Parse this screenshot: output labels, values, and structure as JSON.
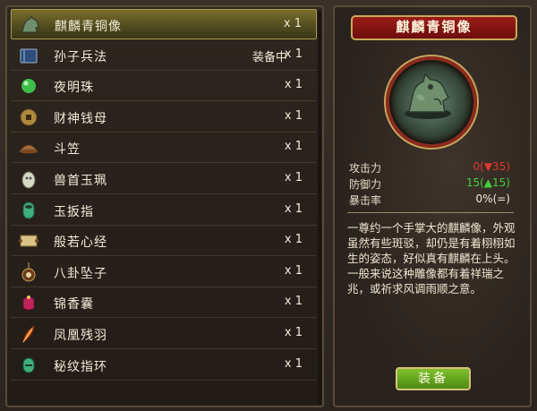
{
  "inventory": {
    "items": [
      {
        "name": "麒麟青铜像",
        "status": "",
        "qty": "x 1",
        "icon": "qilin-statue-icon",
        "selected": true
      },
      {
        "name": "孙子兵法",
        "status": "装备中",
        "qty": "x 1",
        "icon": "book-icon",
        "selected": false
      },
      {
        "name": "夜明珠",
        "status": "",
        "qty": "x 1",
        "icon": "pearl-icon",
        "selected": false
      },
      {
        "name": "财神钱母",
        "status": "",
        "qty": "x 1",
        "icon": "coin-icon",
        "selected": false
      },
      {
        "name": "斗笠",
        "status": "",
        "qty": "x 1",
        "icon": "bamboo-hat-icon",
        "selected": false
      },
      {
        "name": "兽首玉珮",
        "status": "",
        "qty": "x 1",
        "icon": "jade-pendant-icon",
        "selected": false
      },
      {
        "name": "玉扳指",
        "status": "",
        "qty": "x 1",
        "icon": "jade-ring-icon",
        "selected": false
      },
      {
        "name": "般若心经",
        "status": "",
        "qty": "x 1",
        "icon": "scroll-icon",
        "selected": false
      },
      {
        "name": "八卦坠子",
        "status": "",
        "qty": "x 1",
        "icon": "bagua-pendant-icon",
        "selected": false
      },
      {
        "name": "锦香囊",
        "status": "",
        "qty": "x 1",
        "icon": "sachet-icon",
        "selected": false
      },
      {
        "name": "凤凰残羽",
        "status": "",
        "qty": "x 1",
        "icon": "feather-icon",
        "selected": false
      },
      {
        "name": "秘纹指环",
        "status": "",
        "qty": "x 1",
        "icon": "rune-ring-icon",
        "selected": false
      }
    ]
  },
  "detail": {
    "title": "麒麟青铜像",
    "stats": [
      {
        "label": "攻击力",
        "value": "0(▼35)",
        "color": "#e0392b"
      },
      {
        "label": "防御力",
        "value": "15(▲15)",
        "color": "#3fd13a"
      },
      {
        "label": "暴击率",
        "value": "0%(=)",
        "color": "#f2ead6"
      }
    ],
    "description": "一尊约一个手掌大的麒麟像，外观虽然有些斑驳，却仍是有着栩栩如生的姿态，好似真有麒麟在上头。一般来说这种雕像都有着祥瑞之兆，或祈求风调雨顺之意。",
    "equip_label": "装备"
  }
}
